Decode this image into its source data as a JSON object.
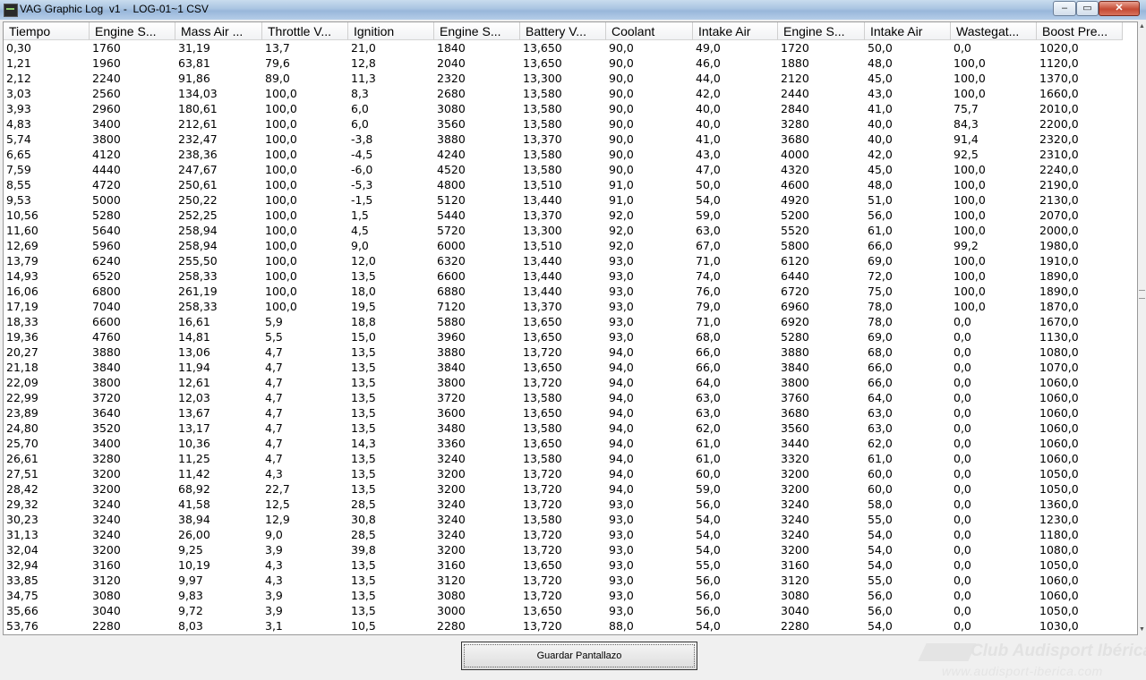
{
  "window": {
    "title": "VAG Graphic Log  v1 -  LOG-01~1 CSV",
    "minimize": "–",
    "maximize": "▭",
    "close": "✕"
  },
  "table": {
    "columns": [
      "Tiempo",
      "Engine S...",
      "Mass Air ...",
      "Throttle V...",
      "Ignition",
      "Engine S...",
      "Battery V...",
      "Coolant",
      "Intake Air",
      "Engine S...",
      "Intake Air",
      "Wastegat...",
      "Boost Pre..."
    ],
    "rows": [
      [
        "0,30",
        "1760",
        "31,19",
        "13,7",
        "21,0",
        "1840",
        "13,650",
        "90,0",
        "49,0",
        "1720",
        "50,0",
        "0,0",
        "1020,0"
      ],
      [
        "1,21",
        "1960",
        "63,81",
        "79,6",
        "12,8",
        "2040",
        "13,650",
        "90,0",
        "46,0",
        "1880",
        "48,0",
        "100,0",
        "1120,0"
      ],
      [
        "2,12",
        "2240",
        "91,86",
        "89,0",
        "11,3",
        "2320",
        "13,300",
        "90,0",
        "44,0",
        "2120",
        "45,0",
        "100,0",
        "1370,0"
      ],
      [
        "3,03",
        "2560",
        "134,03",
        "100,0",
        "8,3",
        "2680",
        "13,580",
        "90,0",
        "42,0",
        "2440",
        "43,0",
        "100,0",
        "1660,0"
      ],
      [
        "3,93",
        "2960",
        "180,61",
        "100,0",
        "6,0",
        "3080",
        "13,580",
        "90,0",
        "40,0",
        "2840",
        "41,0",
        "75,7",
        "2010,0"
      ],
      [
        "4,83",
        "3400",
        "212,61",
        "100,0",
        "6,0",
        "3560",
        "13,580",
        "90,0",
        "40,0",
        "3280",
        "40,0",
        "84,3",
        "2200,0"
      ],
      [
        "5,74",
        "3800",
        "232,47",
        "100,0",
        "-3,8",
        "3880",
        "13,370",
        "90,0",
        "41,0",
        "3680",
        "40,0",
        "91,4",
        "2320,0"
      ],
      [
        "6,65",
        "4120",
        "238,36",
        "100,0",
        "-4,5",
        "4240",
        "13,580",
        "90,0",
        "43,0",
        "4000",
        "42,0",
        "92,5",
        "2310,0"
      ],
      [
        "7,59",
        "4440",
        "247,67",
        "100,0",
        "-6,0",
        "4520",
        "13,580",
        "90,0",
        "47,0",
        "4320",
        "45,0",
        "100,0",
        "2240,0"
      ],
      [
        "8,55",
        "4720",
        "250,61",
        "100,0",
        "-5,3",
        "4800",
        "13,510",
        "91,0",
        "50,0",
        "4600",
        "48,0",
        "100,0",
        "2190,0"
      ],
      [
        "9,53",
        "5000",
        "250,22",
        "100,0",
        "-1,5",
        "5120",
        "13,440",
        "91,0",
        "54,0",
        "4920",
        "51,0",
        "100,0",
        "2130,0"
      ],
      [
        "10,56",
        "5280",
        "252,25",
        "100,0",
        "1,5",
        "5440",
        "13,370",
        "92,0",
        "59,0",
        "5200",
        "56,0",
        "100,0",
        "2070,0"
      ],
      [
        "11,60",
        "5640",
        "258,94",
        "100,0",
        "4,5",
        "5720",
        "13,300",
        "92,0",
        "63,0",
        "5520",
        "61,0",
        "100,0",
        "2000,0"
      ],
      [
        "12,69",
        "5960",
        "258,94",
        "100,0",
        "9,0",
        "6000",
        "13,510",
        "92,0",
        "67,0",
        "5800",
        "66,0",
        "99,2",
        "1980,0"
      ],
      [
        "13,79",
        "6240",
        "255,50",
        "100,0",
        "12,0",
        "6320",
        "13,440",
        "93,0",
        "71,0",
        "6120",
        "69,0",
        "100,0",
        "1910,0"
      ],
      [
        "14,93",
        "6520",
        "258,33",
        "100,0",
        "13,5",
        "6600",
        "13,440",
        "93,0",
        "74,0",
        "6440",
        "72,0",
        "100,0",
        "1890,0"
      ],
      [
        "16,06",
        "6800",
        "261,19",
        "100,0",
        "18,0",
        "6880",
        "13,440",
        "93,0",
        "76,0",
        "6720",
        "75,0",
        "100,0",
        "1890,0"
      ],
      [
        "17,19",
        "7040",
        "258,33",
        "100,0",
        "19,5",
        "7120",
        "13,370",
        "93,0",
        "79,0",
        "6960",
        "78,0",
        "100,0",
        "1870,0"
      ],
      [
        "18,33",
        "6600",
        "16,61",
        "5,9",
        "18,8",
        "5880",
        "13,650",
        "93,0",
        "71,0",
        "6920",
        "78,0",
        "0,0",
        "1670,0"
      ],
      [
        "19,36",
        "4760",
        "14,81",
        "5,5",
        "15,0",
        "3960",
        "13,650",
        "93,0",
        "68,0",
        "5280",
        "69,0",
        "0,0",
        "1130,0"
      ],
      [
        "20,27",
        "3880",
        "13,06",
        "4,7",
        "13,5",
        "3880",
        "13,720",
        "94,0",
        "66,0",
        "3880",
        "68,0",
        "0,0",
        "1080,0"
      ],
      [
        "21,18",
        "3840",
        "11,94",
        "4,7",
        "13,5",
        "3840",
        "13,650",
        "94,0",
        "66,0",
        "3840",
        "66,0",
        "0,0",
        "1070,0"
      ],
      [
        "22,09",
        "3800",
        "12,61",
        "4,7",
        "13,5",
        "3800",
        "13,720",
        "94,0",
        "64,0",
        "3800",
        "66,0",
        "0,0",
        "1060,0"
      ],
      [
        "22,99",
        "3720",
        "12,03",
        "4,7",
        "13,5",
        "3720",
        "13,580",
        "94,0",
        "63,0",
        "3760",
        "64,0",
        "0,0",
        "1060,0"
      ],
      [
        "23,89",
        "3640",
        "13,67",
        "4,7",
        "13,5",
        "3600",
        "13,650",
        "94,0",
        "63,0",
        "3680",
        "63,0",
        "0,0",
        "1060,0"
      ],
      [
        "24,80",
        "3520",
        "13,17",
        "4,7",
        "13,5",
        "3480",
        "13,580",
        "94,0",
        "62,0",
        "3560",
        "63,0",
        "0,0",
        "1060,0"
      ],
      [
        "25,70",
        "3400",
        "10,36",
        "4,7",
        "14,3",
        "3360",
        "13,650",
        "94,0",
        "61,0",
        "3440",
        "62,0",
        "0,0",
        "1060,0"
      ],
      [
        "26,61",
        "3280",
        "11,25",
        "4,7",
        "13,5",
        "3240",
        "13,580",
        "94,0",
        "61,0",
        "3320",
        "61,0",
        "0,0",
        "1060,0"
      ],
      [
        "27,51",
        "3200",
        "11,42",
        "4,3",
        "13,5",
        "3200",
        "13,720",
        "94,0",
        "60,0",
        "3200",
        "60,0",
        "0,0",
        "1050,0"
      ],
      [
        "28,42",
        "3200",
        "68,92",
        "22,7",
        "13,5",
        "3200",
        "13,720",
        "94,0",
        "59,0",
        "3200",
        "60,0",
        "0,0",
        "1050,0"
      ],
      [
        "29,32",
        "3240",
        "41,58",
        "12,5",
        "28,5",
        "3240",
        "13,720",
        "93,0",
        "56,0",
        "3240",
        "58,0",
        "0,0",
        "1360,0"
      ],
      [
        "30,23",
        "3240",
        "38,94",
        "12,9",
        "30,8",
        "3240",
        "13,580",
        "93,0",
        "54,0",
        "3240",
        "55,0",
        "0,0",
        "1230,0"
      ],
      [
        "31,13",
        "3240",
        "26,00",
        "9,0",
        "28,5",
        "3240",
        "13,720",
        "93,0",
        "54,0",
        "3240",
        "54,0",
        "0,0",
        "1180,0"
      ],
      [
        "32,04",
        "3200",
        "9,25",
        "3,9",
        "39,8",
        "3200",
        "13,720",
        "93,0",
        "54,0",
        "3200",
        "54,0",
        "0,0",
        "1080,0"
      ],
      [
        "32,94",
        "3160",
        "10,19",
        "4,3",
        "13,5",
        "3160",
        "13,650",
        "93,0",
        "55,0",
        "3160",
        "54,0",
        "0,0",
        "1050,0"
      ],
      [
        "33,85",
        "3120",
        "9,97",
        "4,3",
        "13,5",
        "3120",
        "13,720",
        "93,0",
        "56,0",
        "3120",
        "55,0",
        "0,0",
        "1060,0"
      ],
      [
        "34,75",
        "3080",
        "9,83",
        "3,9",
        "13,5",
        "3080",
        "13,720",
        "93,0",
        "56,0",
        "3080",
        "56,0",
        "0,0",
        "1060,0"
      ],
      [
        "35,66",
        "3040",
        "9,72",
        "3,9",
        "13,5",
        "3000",
        "13,650",
        "93,0",
        "56,0",
        "3040",
        "56,0",
        "0,0",
        "1050,0"
      ],
      [
        "53,76",
        "2280",
        "8,03",
        "3,1",
        "10,5",
        "2280",
        "13,720",
        "88,0",
        "54,0",
        "2280",
        "54,0",
        "0,0",
        "1030,0"
      ]
    ]
  },
  "footer": {
    "save_label": "Guardar Pantallazo"
  },
  "watermark": {
    "name": "Club Audisport Ibérica",
    "url": "www.audisport-iberica.com"
  }
}
